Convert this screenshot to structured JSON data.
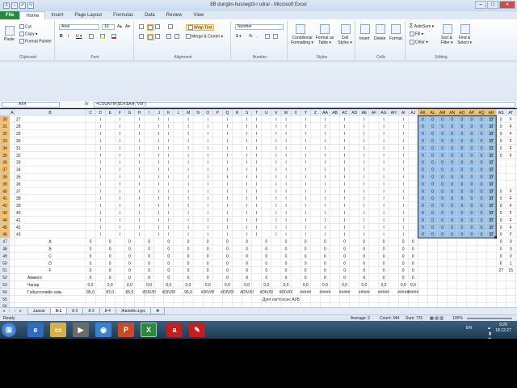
{
  "window": {
    "title": "8B dungiin-husnegt3-r uliral  -  Microsoft Excel"
  },
  "ribbon_tabs": [
    "File",
    "Home",
    "Insert",
    "Page Layout",
    "Formulas",
    "Data",
    "Review",
    "View"
  ],
  "clipboard": {
    "paste": "Paste",
    "cut": "Cut",
    "copy": "Copy ▾",
    "painter": "Format Painter",
    "label": "Clipboard"
  },
  "font": {
    "name": "Arial",
    "size": "10",
    "label": "Font",
    "bold": "B",
    "italic": "I",
    "underline": "U ▾",
    "grow": "A▴",
    "shrink": "A▾"
  },
  "alignment": {
    "wrap": "Wrap Text",
    "merge": "Merge & Center ▾",
    "label": "Alignment"
  },
  "number": {
    "format": "Number",
    "currency": "$ ▾",
    "percent": "%",
    "comma": ",",
    "label": "Number"
  },
  "styles": {
    "conditional": "Conditional Formatting ▾",
    "table": "Format as Table ▾",
    "cell": "Cell Styles ▾",
    "label": "Styles"
  },
  "cells": {
    "insert": "Insert",
    "delete": "Delete",
    "format": "Format",
    "label": "Cells"
  },
  "editing": {
    "autosum": "AutoSum ▾",
    "fill": "Fill ▾",
    "clear": "Clear ▾",
    "sort": "Sort & Filter ▾",
    "find": "Find & Select ▾",
    "label": "Editing"
  },
  "formula_bar": {
    "name_box": "AK4",
    "fx": "fx",
    "formula": "=COUNTIF($C4:$AI4;\"VIII\")"
  },
  "columns": [
    "A",
    "B",
    "C",
    "D",
    "E",
    "F",
    "G",
    "H",
    "I",
    "J",
    "K",
    "L",
    "M",
    "N",
    "O",
    "P",
    "Q",
    "R",
    "S",
    "T",
    "U",
    "V",
    "W",
    "X",
    "Y",
    "Z",
    "AA",
    "AB",
    "AC",
    "AD",
    "AE",
    "AF",
    "AG",
    "AH",
    "AI",
    "AJ",
    "AK",
    "AL",
    "AM",
    "AN",
    "AO",
    "AP",
    "AQ",
    "AR",
    "AS",
    "AT",
    "AU"
  ],
  "rows": {
    "data_row_numbers": [
      "30",
      "31",
      "32",
      "33",
      "34",
      "35",
      "36",
      "37",
      "38",
      "39",
      "40",
      "41",
      "42",
      "43",
      "44",
      "45",
      "46"
    ],
    "data_row_index": [
      "27",
      "28",
      "29",
      "30",
      "31",
      "32",
      "33",
      "34",
      "35",
      "36",
      "37",
      "38",
      "39",
      "40",
      "41",
      "42",
      "43"
    ],
    "summary_row_numbers": [
      "47",
      "48",
      "49",
      "50",
      "51",
      "52",
      "53",
      "54",
      "55",
      "56"
    ],
    "summary_labels": [
      "A",
      "B",
      "C",
      "D",
      "F",
      "Амжилт",
      "Чанар",
      "Гүйцэтгэлийн хувь",
      "",
      ""
    ],
    "summary_row_values": [
      [
        "0",
        "0",
        "0",
        "0",
        "0",
        "0",
        "0",
        "0",
        "0",
        "0",
        "0",
        "0",
        "0",
        "0",
        "0",
        "0",
        "0",
        "0"
      ],
      [
        "0",
        "0",
        "0",
        "0",
        "0",
        "0",
        "0",
        "0",
        "0",
        "0",
        "0",
        "0",
        "0",
        "0",
        "0",
        "0",
        "0",
        "0"
      ],
      [
        "0",
        "0",
        "0",
        "0",
        "0",
        "0",
        "0",
        "0",
        "0",
        "0",
        "0",
        "0",
        "0",
        "0",
        "0",
        "0",
        "0",
        "0"
      ],
      [
        "0",
        "0",
        "0",
        "0",
        "0",
        "0",
        "0",
        "0",
        "0",
        "0",
        "0",
        "0",
        "0",
        "0",
        "0",
        "0",
        "0",
        "0"
      ],
      [
        "0",
        "0",
        "0",
        "0",
        "0",
        "0",
        "0",
        "0",
        "0",
        "0",
        "0",
        "0",
        "0",
        "0",
        "0",
        "0",
        "0",
        "0"
      ],
      [
        "0",
        "0",
        "0",
        "0",
        "0",
        "0",
        "0",
        "0",
        "0",
        "0",
        "0",
        "0",
        "0",
        "0",
        "0",
        "0",
        "0",
        "0"
      ],
      [
        "0,0",
        "0,0",
        "0,0",
        "0,0",
        "0,0",
        "0,0",
        "0,0",
        "0,0",
        "0,0",
        "0,0",
        "0,0",
        "0,0",
        "0,0",
        "0,0",
        "0,0",
        "0,0",
        "0,0",
        "0,0"
      ],
      [
        "95,0",
        "87,0",
        "65,0",
        "#DIV/0!",
        "#DIV/0!",
        "95,0",
        "#DIV/0!",
        "#DIV/0!",
        "#DIV/0!",
        "#DIV/0!",
        "#DIV/0!",
        "#####",
        "#####",
        "#####",
        "#####",
        "#####",
        "#####",
        "#####"
      ]
    ],
    "data_cells": {
      "blue_values": [
        "0",
        "0",
        "0",
        "0",
        "0",
        "0",
        "0",
        "0",
        "17"
      ],
      "mark": "I"
    },
    "footer_text": "Дүнг нэгтгэсэн: АУБ"
  },
  "right_cols": {
    "as_values": [
      "0",
      "0",
      "0",
      "0",
      "0",
      "0",
      "",
      "",
      "",
      "",
      "0",
      "0",
      "0",
      "0",
      "0",
      "0",
      "0"
    ],
    "at_values": [
      "F",
      "F",
      "F",
      "F",
      "F",
      "F",
      "",
      "",
      "",
      "",
      "F",
      "F",
      "F",
      "F",
      "F",
      "F",
      "F"
    ],
    "au_values": [
      "##",
      "##",
      "##",
      "##",
      "##",
      "##",
      "",
      "",
      "",
      "",
      "##",
      "##",
      "##",
      "##",
      "##",
      "##",
      "##"
    ],
    "summary_at": [
      "0",
      "0",
      "0",
      "1",
      "15"
    ],
    "summary_as": [
      "0",
      "0",
      "0",
      "5",
      "27"
    ]
  },
  "sheet_tabs": [
    "zaavar",
    "8-1",
    "8-2",
    "8-3",
    "8-4",
    "Жилийн зүрс"
  ],
  "status": {
    "ready": "Ready",
    "average": "Average: 2",
    "count": "Count: 344",
    "sum": "Sum: 731",
    "zoom": "100%"
  },
  "taskbar": {
    "time": "9:26",
    "date": "18.12.27",
    "lang": "EN"
  },
  "colors": {
    "blue_fill": "#9cc3e6",
    "header_sel": "#f5c16c",
    "row_sel": "#f5c16c",
    "excel_green": "#2a8a3a"
  }
}
